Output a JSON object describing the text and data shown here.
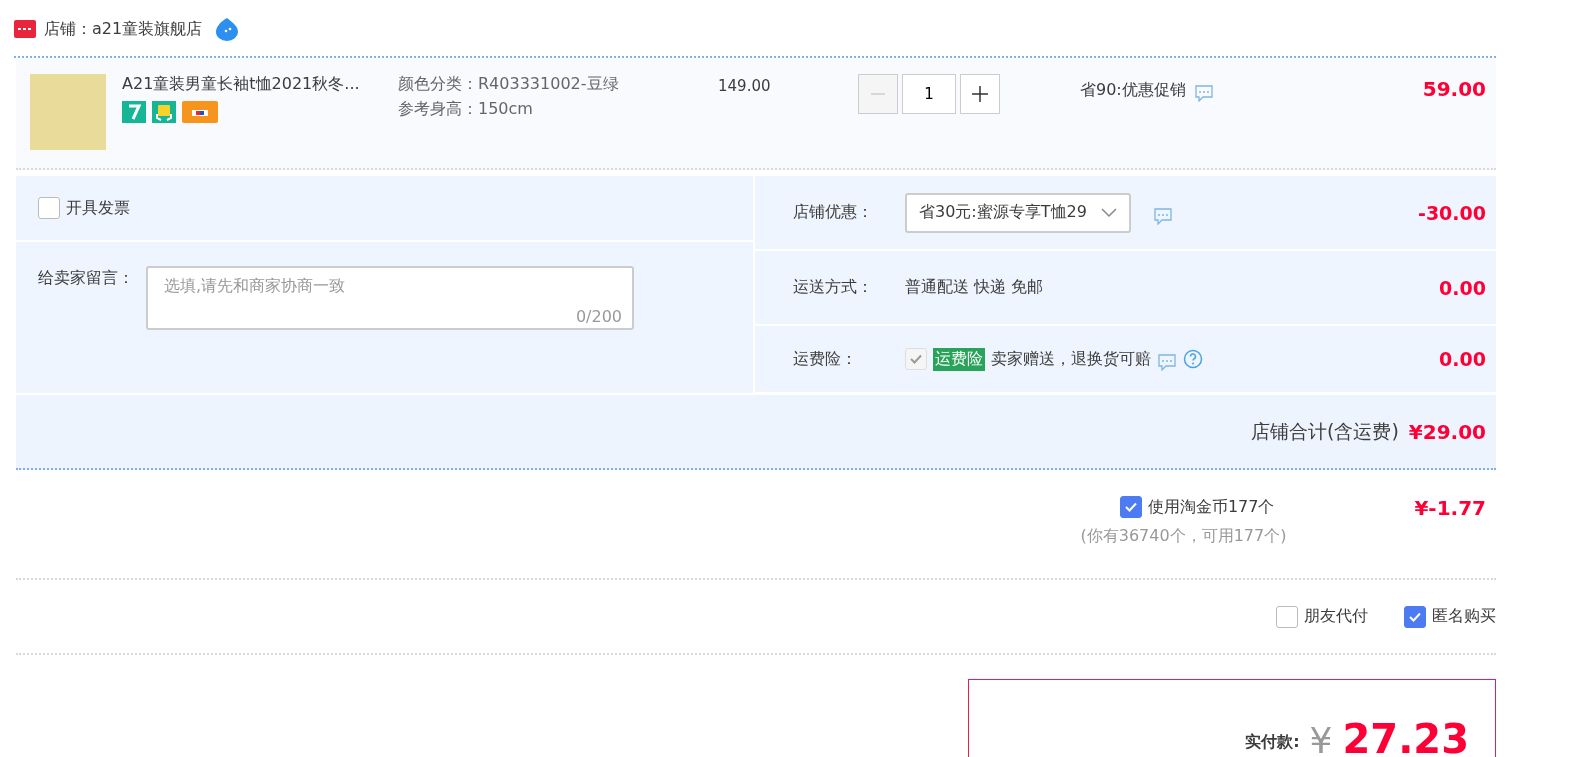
{
  "shop": {
    "name": "店铺：a21童装旗舰店"
  },
  "item": {
    "title": "A21童装男童长袖t恤2021秋冬...",
    "sku": [
      {
        "label": "颜色分类：",
        "value": "R403331002-豆绿"
      },
      {
        "label": "参考身高：",
        "value": "150cm"
      }
    ],
    "price": "149.00",
    "minus_disabled": true,
    "quantity": "1",
    "promo": "省90:优惠促销",
    "total": "59.00"
  },
  "invoice": {
    "label": "开具发票",
    "checked": false
  },
  "message": {
    "label": "给卖家留言：",
    "placeholder": "选填,请先和商家协商一致",
    "counter": "0/200"
  },
  "options": [
    {
      "kind": "select",
      "label": "店铺优惠：",
      "value": "省30元:蜜源专享T恤29",
      "amount": "-30.00"
    },
    {
      "kind": "text",
      "label": "运送方式：",
      "value": "普通配送 快递 免邮",
      "amount": "0.00"
    },
    {
      "kind": "insurance",
      "label": "运费险：",
      "badge": "运费险",
      "value": "卖家赠送，退换货可赔",
      "checked": true,
      "disabled": true,
      "amount": "0.00"
    }
  ],
  "shop_total": {
    "label": "店铺合计(含运费)",
    "amount": "¥29.00"
  },
  "coins": {
    "label": "使用淘金币177个",
    "checked": true,
    "note": "(你有36740个，可用177个)",
    "amount": "¥-1.77"
  },
  "extras": [
    {
      "label": "朋友代付",
      "checked": false
    },
    {
      "label": "匿名购买",
      "checked": true
    }
  ],
  "payment": {
    "label": "实付款:",
    "currency": "¥",
    "amount": "27.23"
  }
}
